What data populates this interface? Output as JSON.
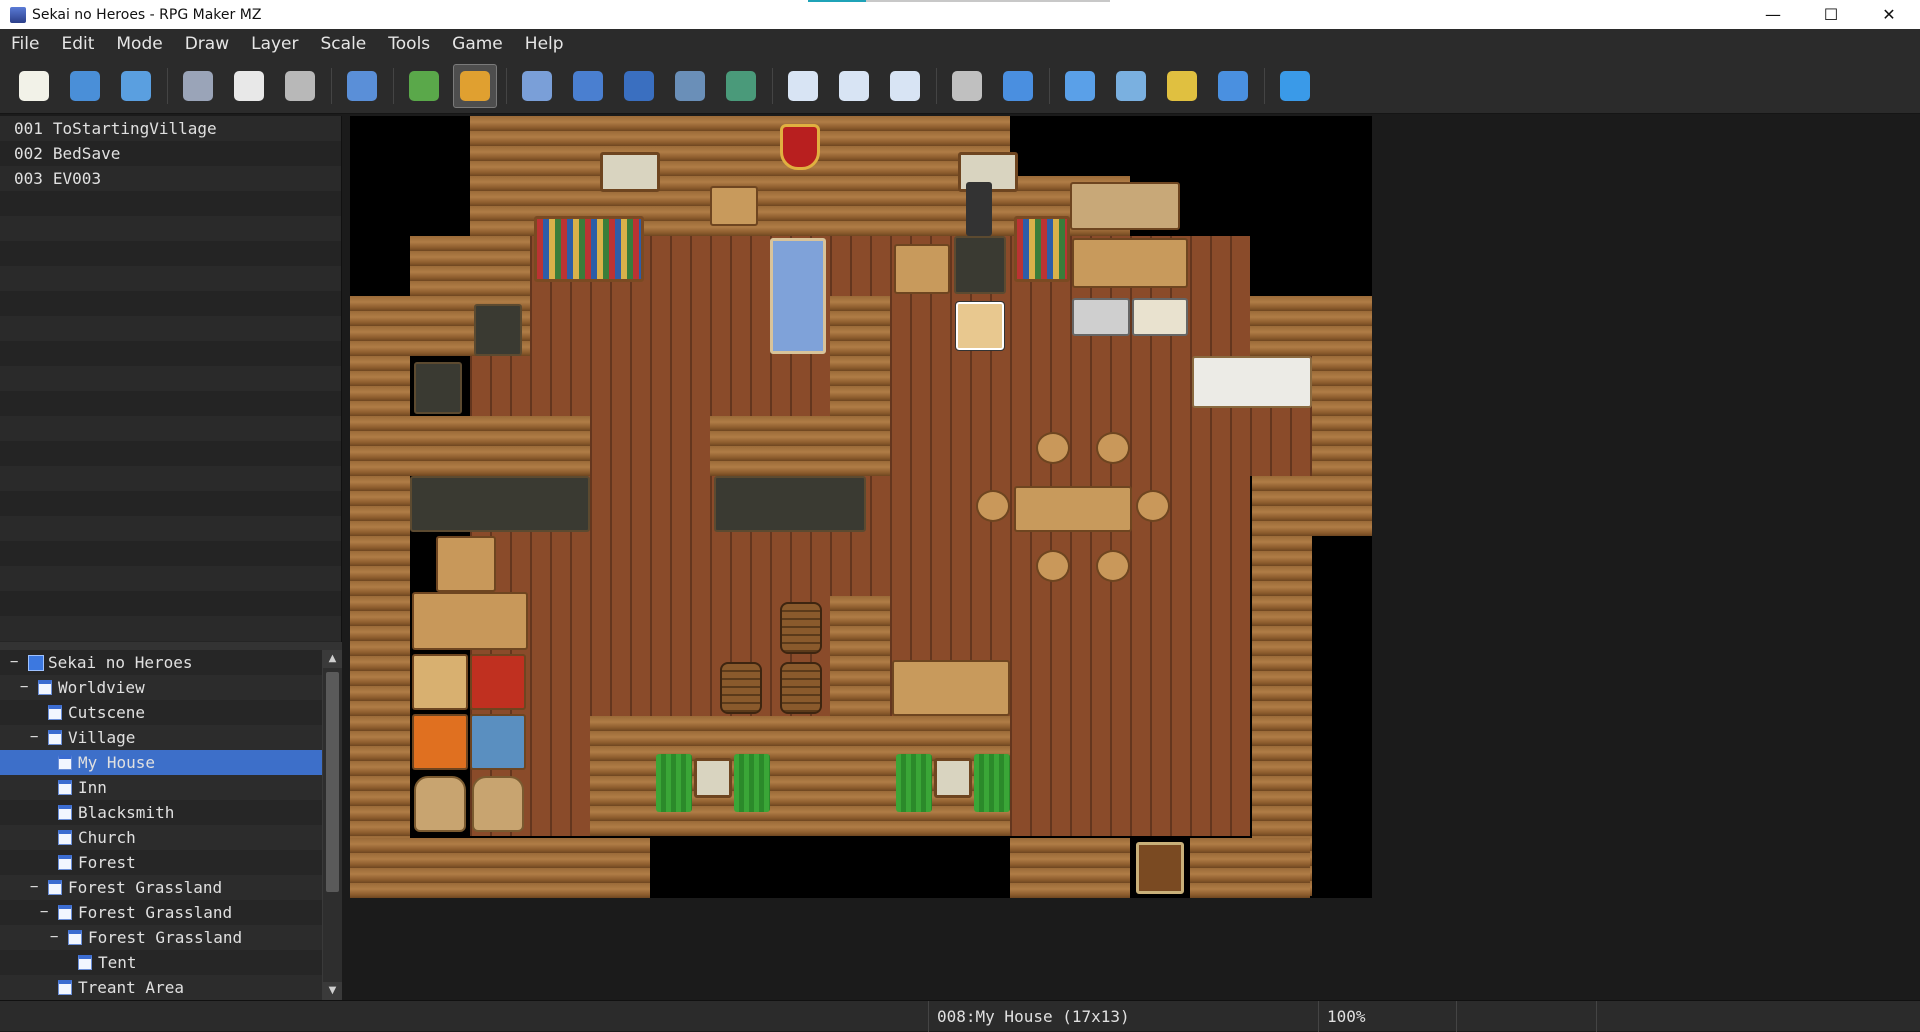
{
  "window": {
    "title": "Sekai no Heroes - RPG Maker MZ",
    "minimize": "—",
    "maximize": "☐",
    "close": "✕"
  },
  "menu": [
    "File",
    "Edit",
    "Mode",
    "Draw",
    "Layer",
    "Scale",
    "Tools",
    "Game",
    "Help"
  ],
  "toolbar": {
    "buttons": [
      {
        "name": "new-project-icon",
        "color": "#f2f2e8"
      },
      {
        "name": "open-project-icon",
        "color": "#4a8fd8"
      },
      {
        "name": "save-project-icon",
        "color": "#5a9fe0"
      },
      {
        "name": "cut-icon",
        "color": "#9aa4b8"
      },
      {
        "name": "copy-icon",
        "color": "#e8e8e8"
      },
      {
        "name": "paste-icon",
        "color": "#b8b8b8"
      },
      {
        "name": "undo-icon",
        "color": "#5a8fd8"
      },
      {
        "name": "map-mode-icon",
        "color": "#5aa84a"
      },
      {
        "name": "event-mode-icon",
        "color": "#e0a030",
        "active": true
      },
      {
        "name": "pencil-icon",
        "color": "#7a9fd8"
      },
      {
        "name": "rectangle-icon",
        "color": "#4a7fd0"
      },
      {
        "name": "ellipse-icon",
        "color": "#3a6fc0"
      },
      {
        "name": "fill-icon",
        "color": "#6a8fb8"
      },
      {
        "name": "shadow-pen-icon",
        "color": "#4a9a7a"
      },
      {
        "name": "zoom-in-icon",
        "color": "#d8e4f4"
      },
      {
        "name": "zoom-out-icon",
        "color": "#d8e4f4"
      },
      {
        "name": "actual-size-icon",
        "color": "#d8e4f4"
      },
      {
        "name": "database-icon",
        "color": "#c0c0c0"
      },
      {
        "name": "plugin-manager-icon",
        "color": "#4a8fe0"
      },
      {
        "name": "sound-test-icon",
        "color": "#5aa0e8"
      },
      {
        "name": "event-searcher-icon",
        "color": "#7ab0e0"
      },
      {
        "name": "resource-manager-icon",
        "color": "#e0c040"
      },
      {
        "name": "character-generator-icon",
        "color": "#4a90e0"
      },
      {
        "name": "playtest-icon",
        "color": "#3a9ae8"
      }
    ]
  },
  "events": [
    {
      "id": "001",
      "name": "ToStartingVillage"
    },
    {
      "id": "002",
      "name": "BedSave"
    },
    {
      "id": "003",
      "name": "EV003"
    }
  ],
  "map_tree": [
    {
      "label": "Sekai no Heroes",
      "level": 0,
      "toggle": "−",
      "root": true
    },
    {
      "label": "Worldview",
      "level": 1,
      "toggle": "−"
    },
    {
      "label": "Cutscene",
      "level": 2,
      "toggle": ""
    },
    {
      "label": "Village",
      "level": 2,
      "toggle": "−"
    },
    {
      "label": "My House",
      "level": 3,
      "toggle": "",
      "selected": true
    },
    {
      "label": "Inn",
      "level": 3,
      "toggle": ""
    },
    {
      "label": "Blacksmith",
      "level": 3,
      "toggle": ""
    },
    {
      "label": "Church",
      "level": 3,
      "toggle": ""
    },
    {
      "label": "Forest",
      "level": 3,
      "toggle": ""
    },
    {
      "label": "Forest Grassland",
      "level": 2,
      "toggle": "−"
    },
    {
      "label": "Forest Grassland",
      "level": 3,
      "toggle": "−"
    },
    {
      "label": "Forest Grassland",
      "level": 4,
      "toggle": "−"
    },
    {
      "label": "Tent",
      "level": 5,
      "toggle": ""
    },
    {
      "label": "Treant Area",
      "level": 3,
      "toggle": ""
    }
  ],
  "status": {
    "map_info": "008:My House (17x13)",
    "zoom": "100%"
  }
}
